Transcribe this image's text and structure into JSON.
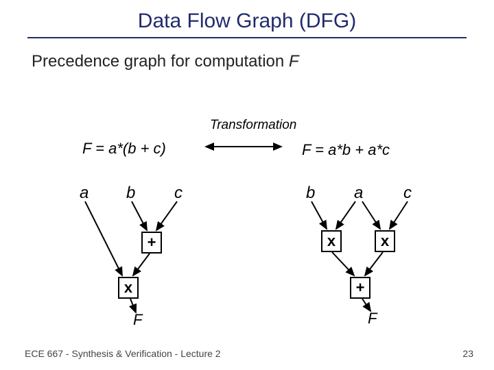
{
  "title": "Data Flow Graph (DFG)",
  "subtitle_prefix": "Precedence graph for computation ",
  "subtitle_var": "F",
  "transformation_label": "Transformation",
  "left": {
    "equation": "F = a*(b + c)",
    "inputs": {
      "a": "a",
      "b": "b",
      "c": "c"
    },
    "ops": {
      "plus": "+",
      "times": "x"
    },
    "out": "F"
  },
  "right": {
    "equation": "F = a*b + a*c",
    "inputs": {
      "b": "b",
      "a": "a",
      "c": "c"
    },
    "ops": {
      "times1": "x",
      "times2": "x",
      "plus": "+"
    },
    "out": "F"
  },
  "footer": {
    "left": "ECE 667 - Synthesis & Verification - Lecture 2",
    "right": "23"
  }
}
